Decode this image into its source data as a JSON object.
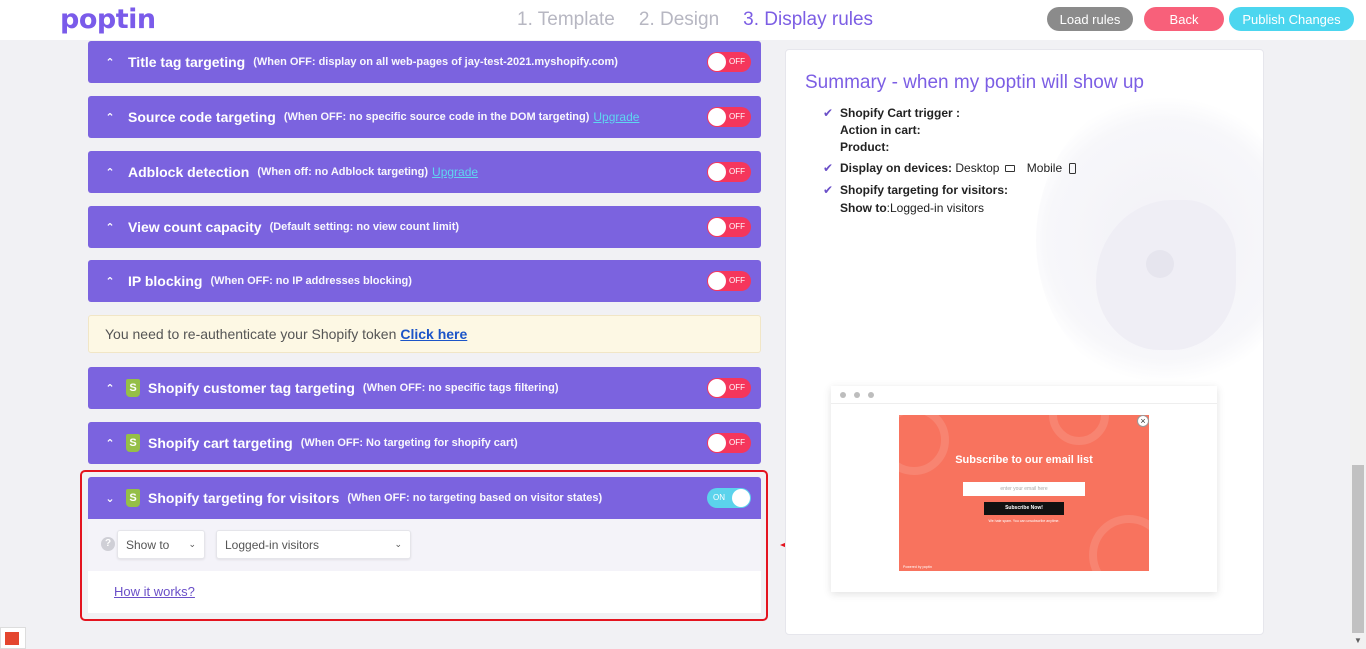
{
  "header": {
    "logo": "poptin",
    "steps": [
      "1. Template",
      "2. Design",
      "3. Display rules"
    ],
    "active_step": 2,
    "buttons": {
      "load": "Load rules",
      "back": "Back",
      "publish": "Publish Changes"
    }
  },
  "rules": [
    {
      "title": "Title tag targeting",
      "desc": "(When OFF: display on all web-pages of jay-test-2021.myshopify.com)",
      "upgrade": "",
      "shopify": false,
      "state": "OFF",
      "expanded": false
    },
    {
      "title": "Source code targeting",
      "desc": "(When OFF: no specific source code in the DOM targeting)",
      "upgrade": "Upgrade",
      "shopify": false,
      "state": "OFF",
      "expanded": false
    },
    {
      "title": "Adblock detection",
      "desc": "(When off: no Adblock targeting)",
      "upgrade": "Upgrade",
      "shopify": false,
      "state": "OFF",
      "expanded": false
    },
    {
      "title": "View count capacity",
      "desc": "(Default setting: no view count limit)",
      "upgrade": "",
      "shopify": false,
      "state": "OFF",
      "expanded": false
    },
    {
      "title": "IP blocking",
      "desc": "(When OFF: no IP addresses blocking)",
      "upgrade": "",
      "shopify": false,
      "state": "OFF",
      "expanded": false
    },
    {
      "title": "Shopify customer tag targeting",
      "desc": "(When OFF: no specific tags filtering)",
      "upgrade": "",
      "shopify": true,
      "state": "OFF",
      "expanded": false
    },
    {
      "title": "Shopify cart targeting",
      "desc": "(When OFF: No targeting for shopify cart)",
      "upgrade": "",
      "shopify": true,
      "state": "OFF",
      "expanded": false
    },
    {
      "title": "Shopify targeting for visitors",
      "desc": "(When OFF: no targeting based on visitor states)",
      "upgrade": "",
      "shopify": true,
      "state": "ON",
      "expanded": true
    }
  ],
  "notice": {
    "text": "You need to re-authenticate your Shopify token",
    "link": "Click here"
  },
  "visitors_panel": {
    "help": "?",
    "show_to": "Show to",
    "visitor_type": "Logged-in visitors",
    "how_it_works": "How it works?"
  },
  "summary": {
    "title": "Summary - when my poptin will show up",
    "cart_trigger": "Shopify Cart trigger :",
    "action_in_cart": "Action in cart:",
    "product": "Product:",
    "devices_label": "Display on devices:",
    "device_desktop": "Desktop",
    "device_mobile": "Mobile",
    "visitors_label": "Shopify targeting for visitors:",
    "show_to_label": "Show to",
    "show_to_value": ":Logged-in visitors"
  },
  "popup_preview": {
    "title": "Subscribe to our email list",
    "input_placeholder": "enter your email here",
    "button": "Subscribe Now!",
    "small": "We hate spam. You can unsubscribe anytime.",
    "brand": "Powered by poptin",
    "close": "×"
  },
  "colors": {
    "accent": "#7b63df",
    "off": "#f5365c",
    "on": "#5bd3ec",
    "popup": "#f8735e"
  }
}
